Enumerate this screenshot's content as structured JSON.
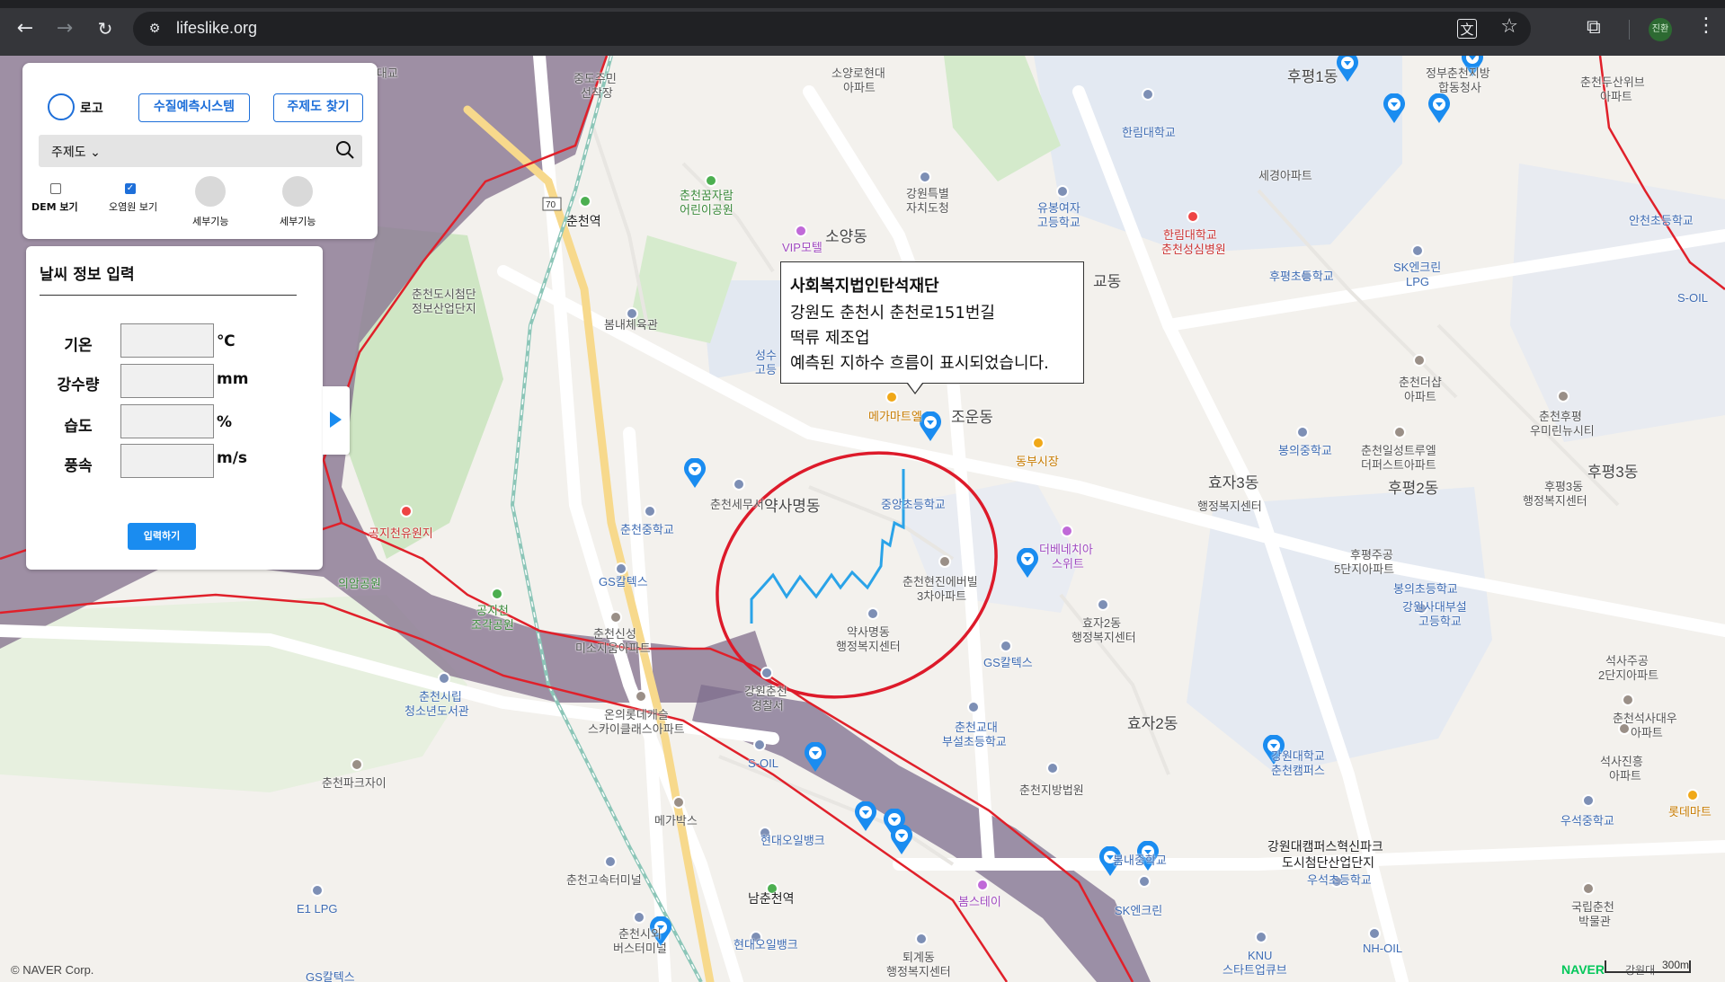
{
  "browser": {
    "url": "lifeslike.org",
    "profile_initials": "진환"
  },
  "panel": {
    "logo_label": "로고",
    "water_quality_button": "수질예측시스템",
    "thematic_map_button": "주제도 찾기",
    "theme_dropdown": "주제도",
    "dem_label": "DEM 보기",
    "dem_checked": false,
    "pollution_label": "오염원 보기",
    "pollution_checked": true,
    "detail_feature_1": "세부기능",
    "detail_feature_2": "세부기능"
  },
  "weather": {
    "title": "날씨 정보 입력",
    "rows": [
      {
        "label": "기온",
        "unit": "℃",
        "value": ""
      },
      {
        "label": "강수량",
        "unit": "mm",
        "value": ""
      },
      {
        "label": "습도",
        "unit": "%",
        "value": ""
      },
      {
        "label": "풍속",
        "unit": "m/s",
        "value": ""
      }
    ],
    "submit_label": "입력하기"
  },
  "callout": {
    "title": "사회복지법인탄석재단",
    "address": "강원도 춘천시 춘천로151번길",
    "business": "떡류 제조업",
    "message": "예측된 지하수 흐름이 표시되었습니다."
  },
  "map": {
    "copyright": "© NAVER Corp.",
    "brand": "NAVER",
    "scale": "300m",
    "labels": {
      "l1": "춘천대교",
      "l2": "중도주민",
      "l3": "선착장",
      "l4": "춘천역",
      "l5": "소양로현대",
      "l6": "아파트",
      "l7": "춘천꿈자람",
      "l8": "어린이공원",
      "l9": "강원특별",
      "l10": "자치도청",
      "l11": "VIP모텔",
      "l12": "소양동",
      "l13": "춘천도시첨단",
      "l14": "정보산업단지",
      "l15": "봄내체육관",
      "l16": "성수",
      "l17": "고등",
      "l18": "교동",
      "l19": "유봉여자",
      "l20": "고등학교",
      "l21": "한림대학교",
      "l22": "한림대학교",
      "l23": "춘천성심병원",
      "l24": "세경아파트",
      "l25": "후평초등학교",
      "l26": "SK엔크린",
      "l27": "LPG",
      "l28": "후평1동",
      "l29": "정부춘천지방",
      "l30": "합동청사",
      "l31": "춘천두산위브",
      "l32": "아파트",
      "l33": "안천초등학교",
      "l34": "S-OIL",
      "l35": "춘천더샵",
      "l36": "아파트",
      "l37": "춘천후평",
      "l38": "우미린뉴시티",
      "l39": "봉의중학교",
      "l40": "춘천일성트루엘",
      "l41": "더퍼스트아파트",
      "l42": "후평3동",
      "l43": "효자3동",
      "l44": "행정복지센터",
      "l45": "후평2동",
      "l46": "후평3동",
      "l47": "행정복지센터",
      "l48": "메가마트엘",
      "l49": "조운동",
      "l50": "동부시장",
      "l51": "춘천세무서",
      "l52": "약사명동",
      "l53": "중앙초등학교",
      "l54": "춘천중학교",
      "l55": "더베네치아",
      "l56": "스위트",
      "l57": "후평주공",
      "l58": "5단지아파트",
      "l59": "봉의초등학교",
      "l60": "GS칼텍스",
      "l61": "춘천현진에버빌",
      "l62": "3차아파트",
      "l63": "공지천유원지",
      "l64": "의암공원",
      "l65": "공지천",
      "l66": "조각공원",
      "l67": "춘천신성",
      "l68": "미소지움아파트",
      "l69": "약사명동",
      "l70": "행정복지센터",
      "l71": "효자2동",
      "l72": "행정복지센터",
      "l73": "GS칼텍스",
      "l74": "강원사대부설",
      "l75": "고등학교",
      "l76": "석사주공",
      "l77": "2단지아파트",
      "l78": "강원춘천",
      "l79": "경찰서",
      "l80": "춘천시립",
      "l81": "청소년도서관",
      "l82": "온의롯데캐슬",
      "l83": "스카이클래스아파트",
      "l84": "춘천교대",
      "l85": "부설초등학교",
      "l86": "효자2동",
      "l87": "춘천석사대우",
      "l88": "아파트",
      "l89": "S-OIL",
      "l90": "춘천파크자이",
      "l91": "강원대학교",
      "l92": "춘천캠퍼스",
      "l93": "석사진흥",
      "l94": "아파트",
      "l95": "롯데마트",
      "l96": "메가박스",
      "l97": "춘천지방법원",
      "l98": "우석중학교",
      "l99": "현대오일뱅크",
      "l100": "봄내중학교",
      "l101": "강원대캠퍼스혁신파크",
      "l102": "도시첨단산업단지",
      "l103": "춘천고속터미널",
      "l104": "남춘천역",
      "l105": "봄스테이",
      "l106": "SK엔크린",
      "l107": "우석초등학교",
      "l108": "E1 LPG",
      "l109": "국립춘천",
      "l110": "박물관",
      "l111": "춘천시외",
      "l112": "버스터미널",
      "l113": "현대오일뱅크",
      "l114": "퇴계동",
      "l115": "행정복지센터",
      "l116": "KNU",
      "l117": "스타트업큐브",
      "l118": "NH-OIL",
      "l119": "GS칼텍스",
      "l120": "70",
      "l121": "강원대"
    }
  },
  "colors": {
    "accent": "#1e6fd9",
    "submit": "#1a8cf0",
    "boundary": "#e0202a",
    "flow_line": "#2aa3e8",
    "river": "#7e6e8e"
  }
}
